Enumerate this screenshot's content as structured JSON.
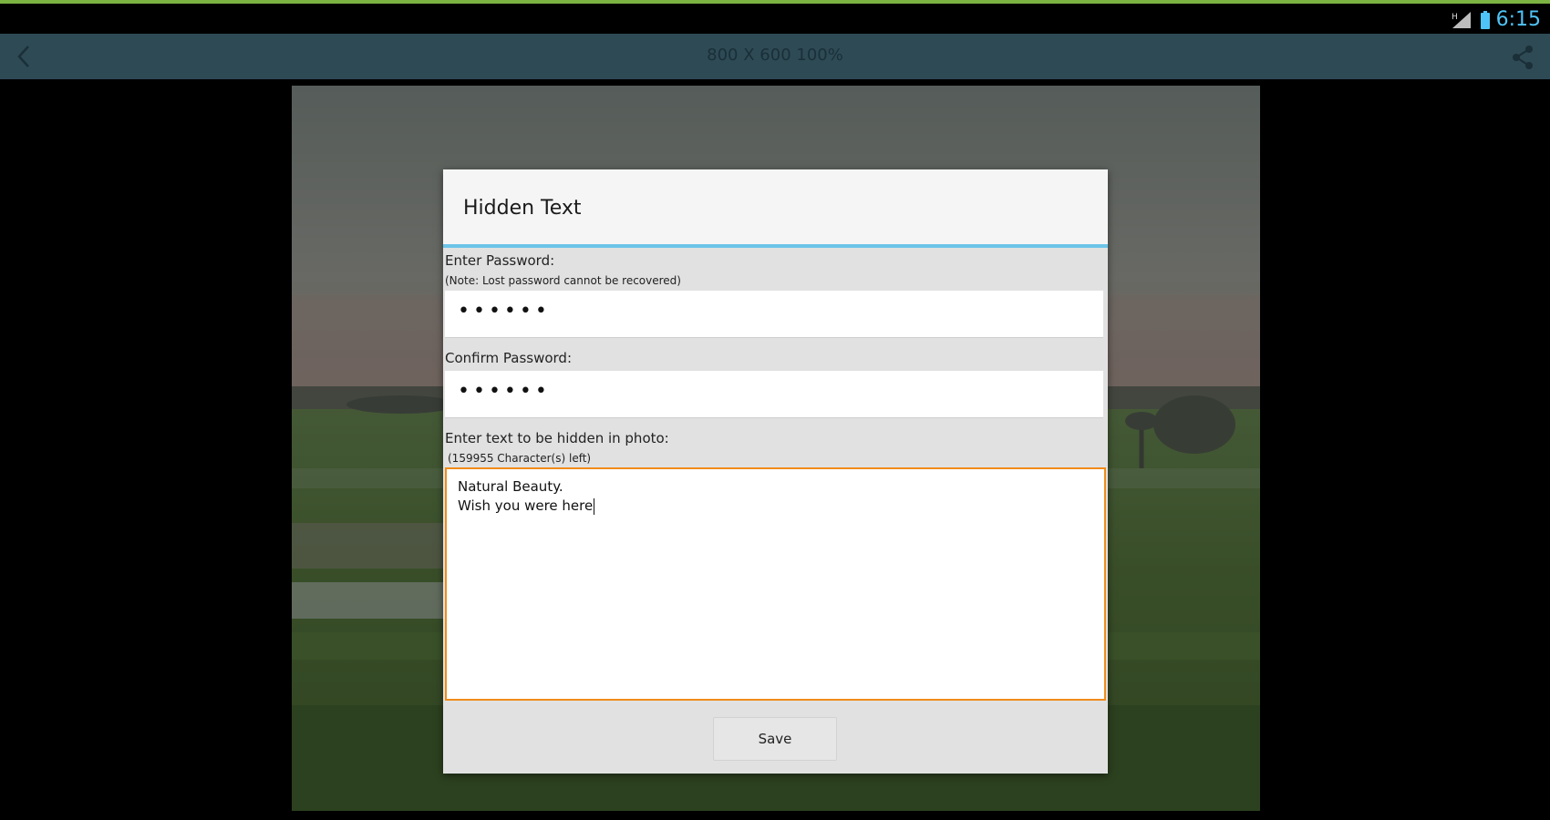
{
  "status_bar": {
    "time": "6:15",
    "signal_icon": "signal-icon",
    "battery_icon": "battery-icon",
    "clock_color": "#4fc3f7"
  },
  "action_bar": {
    "title": "800 X 600 100%",
    "back_icon": "chevron-left-icon",
    "share_icon": "share-icon",
    "background": "#2e4a55"
  },
  "dialog": {
    "title": "Hidden Text",
    "password_label": "Enter Password:",
    "password_note": "(Note: Lost password cannot be recovered)",
    "password_value": "••••••",
    "confirm_label": "Confirm Password:",
    "confirm_value": "••••••",
    "hidden_text_label": "Enter text to be hidden in photo:",
    "chars_left": "(159955 Character(s) left)",
    "hidden_text_lines": [
      "Natural Beauty.",
      "Wish you were here"
    ],
    "save_label": "Save",
    "accent_color": "#f08c1a",
    "header_divider_color": "#6cc4e8"
  }
}
